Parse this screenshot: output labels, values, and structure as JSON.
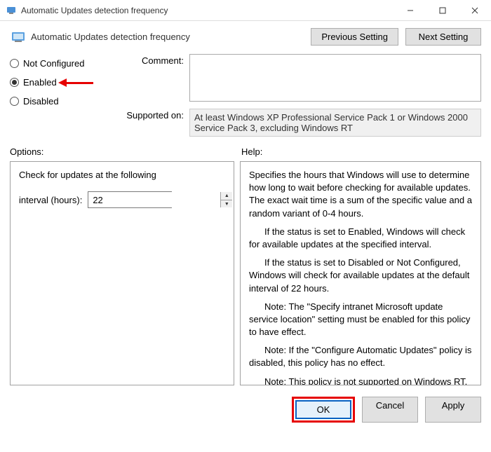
{
  "window": {
    "title": "Automatic Updates detection frequency"
  },
  "header": {
    "title": "Automatic Updates detection frequency",
    "previous": "Previous Setting",
    "next": "Next Setting"
  },
  "radios": {
    "not_configured": "Not Configured",
    "enabled": "Enabled",
    "disabled": "Disabled",
    "selected": "enabled"
  },
  "form": {
    "comment_label": "Comment:",
    "comment_value": "",
    "supported_label": "Supported on:",
    "supported_value": "At least Windows XP Professional Service Pack 1 or Windows 2000 Service Pack 3, excluding Windows RT"
  },
  "sections": {
    "options": "Options:",
    "help": "Help:"
  },
  "options": {
    "line1": "Check for updates at the following",
    "interval_label": "interval (hours):",
    "interval_value": "22"
  },
  "help": {
    "p1": "Specifies the hours that Windows will use to determine how long to wait before checking for available updates. The exact wait time is a sum of the specific value and a random variant of 0-4 hours.",
    "p2": "If the status is set to Enabled, Windows will check for available updates at the specified interval.",
    "p3": "If the status is set to Disabled or Not Configured, Windows will check for available updates at the default interval of 22 hours.",
    "p4": "Note: The \"Specify intranet Microsoft update service location\" setting must be enabled for this policy to have effect.",
    "p5": "Note: If the \"Configure Automatic Updates\" policy is disabled, this policy has no effect.",
    "p6": "Note: This policy is not supported on Windows RT. Setting this policy will not have any effect on Windows RT PCs."
  },
  "buttons": {
    "ok": "OK",
    "cancel": "Cancel",
    "apply": "Apply"
  }
}
